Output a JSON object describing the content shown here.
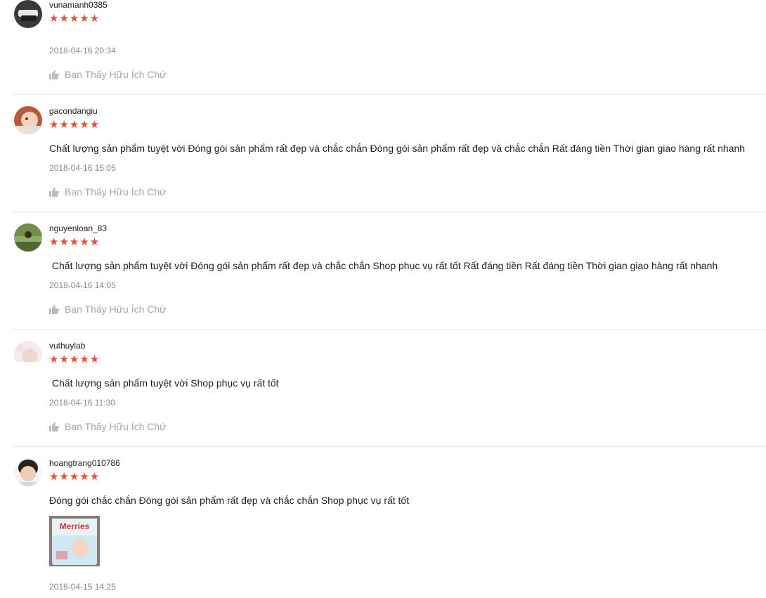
{
  "reviews": [
    {
      "username": "vunamanh0385",
      "stars": "★★★★★",
      "comment": "",
      "date": "2018-04-16 20:34",
      "helpful": "Bạn Thấy Hữu Ích Chứ"
    },
    {
      "username": "gacondangiu",
      "stars": "★★★★★",
      "comment": "Chất lượng sản phẩm tuyệt vời Đóng gói sản phẩm rất đẹp và chắc chắn Đóng gói sản phẩm rất đẹp và chắc chắn Rất đáng tiền Thời gian giao hàng rất nhanh",
      "date": "2018-04-16 15:05",
      "helpful": "Bạn Thấy Hữu Ích Chứ"
    },
    {
      "username": "nguyenloan_83",
      "stars": "★★★★★",
      "comment": " Chất lượng sản phẩm tuyệt vời Đóng gói sản phẩm rất đẹp và chắc chắn Shop phục vụ rất tốt Rất đáng tiền Rất đáng tiền Thời gian giao hàng rất nhanh",
      "date": "2018-04-16 14:05",
      "helpful": "Bạn Thấy Hữu Ích Chứ"
    },
    {
      "username": "vuthuylab",
      "stars": "★★★★★",
      "comment": " Chất lượng sản phẩm tuyệt vời Shop phục vụ rất tốt",
      "date": "2018-04-16 11:30",
      "helpful": "Bạn Thấy Hữu Ích Chứ"
    },
    {
      "username": "hoangtrang010786",
      "stars": "★★★★★",
      "comment": "Đóng gói chắc chắn Đóng gói sản phẩm rất đẹp và chắc chắn Shop phục vụ rất tốt",
      "photo_brand_text": "Merries",
      "date": "2018-04-15 14:25"
    }
  ],
  "colors": {
    "star": "#ee4d2d",
    "date": "#8a8a8a",
    "helpful": "#a6a6a6",
    "divider": "#e8e8e8"
  },
  "icons": {
    "helpful": "thumbs-up-icon",
    "rating": "star-icon"
  }
}
